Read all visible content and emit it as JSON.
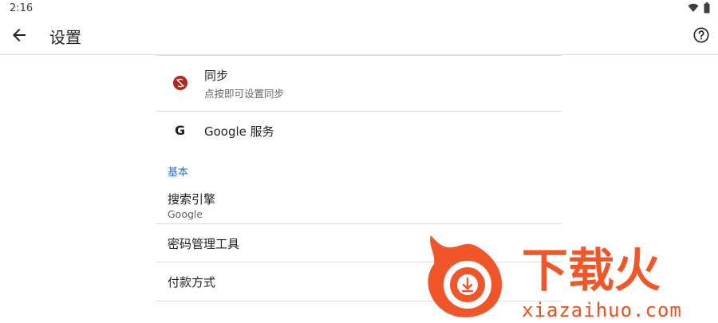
{
  "status_bar": {
    "time": "2:16",
    "icons": [
      "wifi-icon",
      "battery-icon"
    ]
  },
  "app_bar": {
    "title": "设置",
    "back_icon": "arrow-left-icon",
    "help_icon": "help-circle-icon"
  },
  "items": [
    {
      "icon": "sync-off-icon",
      "title": "同步",
      "summary": "点按即可设置同步"
    },
    {
      "icon": "google-g-icon",
      "title": "Google 服务",
      "glyph": "G"
    }
  ],
  "section": {
    "header": "基本"
  },
  "basic_items": [
    {
      "title": "搜索引擎",
      "summary": "Google"
    },
    {
      "title": "密码管理工具"
    },
    {
      "title": "付款方式"
    }
  ],
  "watermark": {
    "logo_text": "下载火",
    "site": "xiazaihuo.com"
  },
  "colors": {
    "accent": "#1a73e8",
    "sync_error": "#b3261e",
    "watermark": "#e8511e"
  }
}
